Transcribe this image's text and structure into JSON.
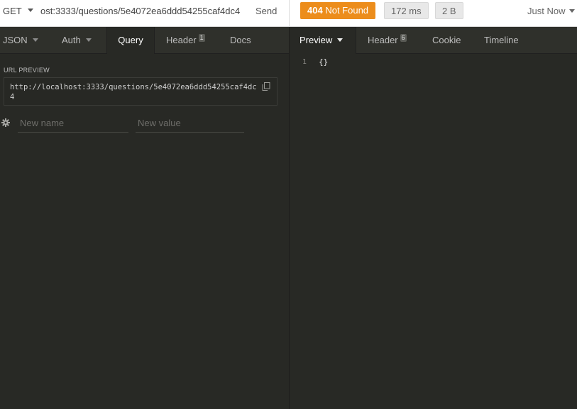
{
  "request": {
    "method": "GET",
    "url": "ost:3333/questions/5e4072ea6ddd54255caf4dc4",
    "send_label": "Send"
  },
  "response": {
    "status_code": "404",
    "status_text": "Not Found",
    "time": "172 ms",
    "size": "2 B",
    "history": "Just Now"
  },
  "request_tabs": [
    {
      "label": "JSON"
    },
    {
      "label": "Auth"
    },
    {
      "label": "Query"
    },
    {
      "label": "Header",
      "count": "1"
    },
    {
      "label": "Docs"
    }
  ],
  "response_tabs": [
    {
      "label": "Preview"
    },
    {
      "label": "Header",
      "count": "6"
    },
    {
      "label": "Cookie"
    },
    {
      "label": "Timeline"
    }
  ],
  "query": {
    "url_preview_label": "URL PREVIEW",
    "url_preview": "http://localhost:3333/questions/5e4072ea6ddd54255caf4dc4",
    "name_placeholder": "New name",
    "value_placeholder": "New value"
  },
  "preview": {
    "line_number": "1",
    "body": "{}"
  },
  "colors": {
    "status_404": "#ec8d1c",
    "panel_bg": "#282925",
    "tabbar_bg": "#2f302b"
  }
}
